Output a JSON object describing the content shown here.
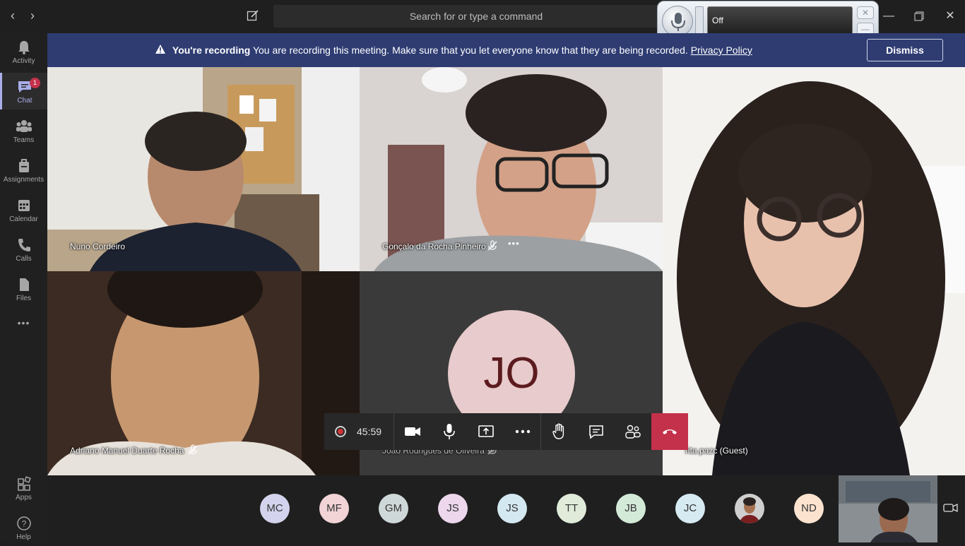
{
  "search": {
    "placeholder": "Search for or type a command"
  },
  "voice": {
    "status": "Off"
  },
  "rail": {
    "items": [
      {
        "label": "Activity",
        "icon": "bell-icon"
      },
      {
        "label": "Chat",
        "icon": "chat-icon",
        "badge": "1"
      },
      {
        "label": "Teams",
        "icon": "teams-icon"
      },
      {
        "label": "Assignments",
        "icon": "assignments-icon"
      },
      {
        "label": "Calendar",
        "icon": "calendar-icon"
      },
      {
        "label": "Calls",
        "icon": "phone-icon"
      },
      {
        "label": "Files",
        "icon": "file-icon"
      },
      {
        "label": "Apps",
        "icon": "apps-icon"
      },
      {
        "label": "Help",
        "icon": "help-icon"
      }
    ],
    "more": "•••"
  },
  "banner": {
    "bold": "You're recording",
    "message": "You are recording this meeting. Make sure that you let everyone know that they are being recorded.",
    "link": "Privacy Policy",
    "dismiss": "Dismiss"
  },
  "participants": [
    {
      "name": "Nuno Cordeiro"
    },
    {
      "name": "Gonçalo da Rocha Pinheiro"
    },
    {
      "name": "rita.pazc (Guest)"
    },
    {
      "name": "Adriano Manuel Duarte Rocha"
    },
    {
      "name": "João Rodrigues de Oliveira",
      "initials": "JO"
    }
  ],
  "controls": {
    "timer": "45:59"
  },
  "roster": [
    {
      "initials": "MC",
      "color": "#d3d3ed"
    },
    {
      "initials": "MF",
      "color": "#f2d3d6"
    },
    {
      "initials": "GM",
      "color": "#cfd8d8"
    },
    {
      "initials": "JS",
      "color": "#ecd7ec"
    },
    {
      "initials": "JS",
      "color": "#d4e8f1"
    },
    {
      "initials": "TT",
      "color": "#e0ecd9"
    },
    {
      "initials": "JB",
      "color": "#d4ead9"
    },
    {
      "initials": "JC",
      "color": "#d6eaf2"
    },
    {
      "initials": "",
      "color": "#555555"
    },
    {
      "initials": "ND",
      "color": "#fbe3cf"
    }
  ],
  "colors": {
    "accent": "#a9aee9",
    "banner": "#2e3c72",
    "hangup": "#c4314b"
  }
}
